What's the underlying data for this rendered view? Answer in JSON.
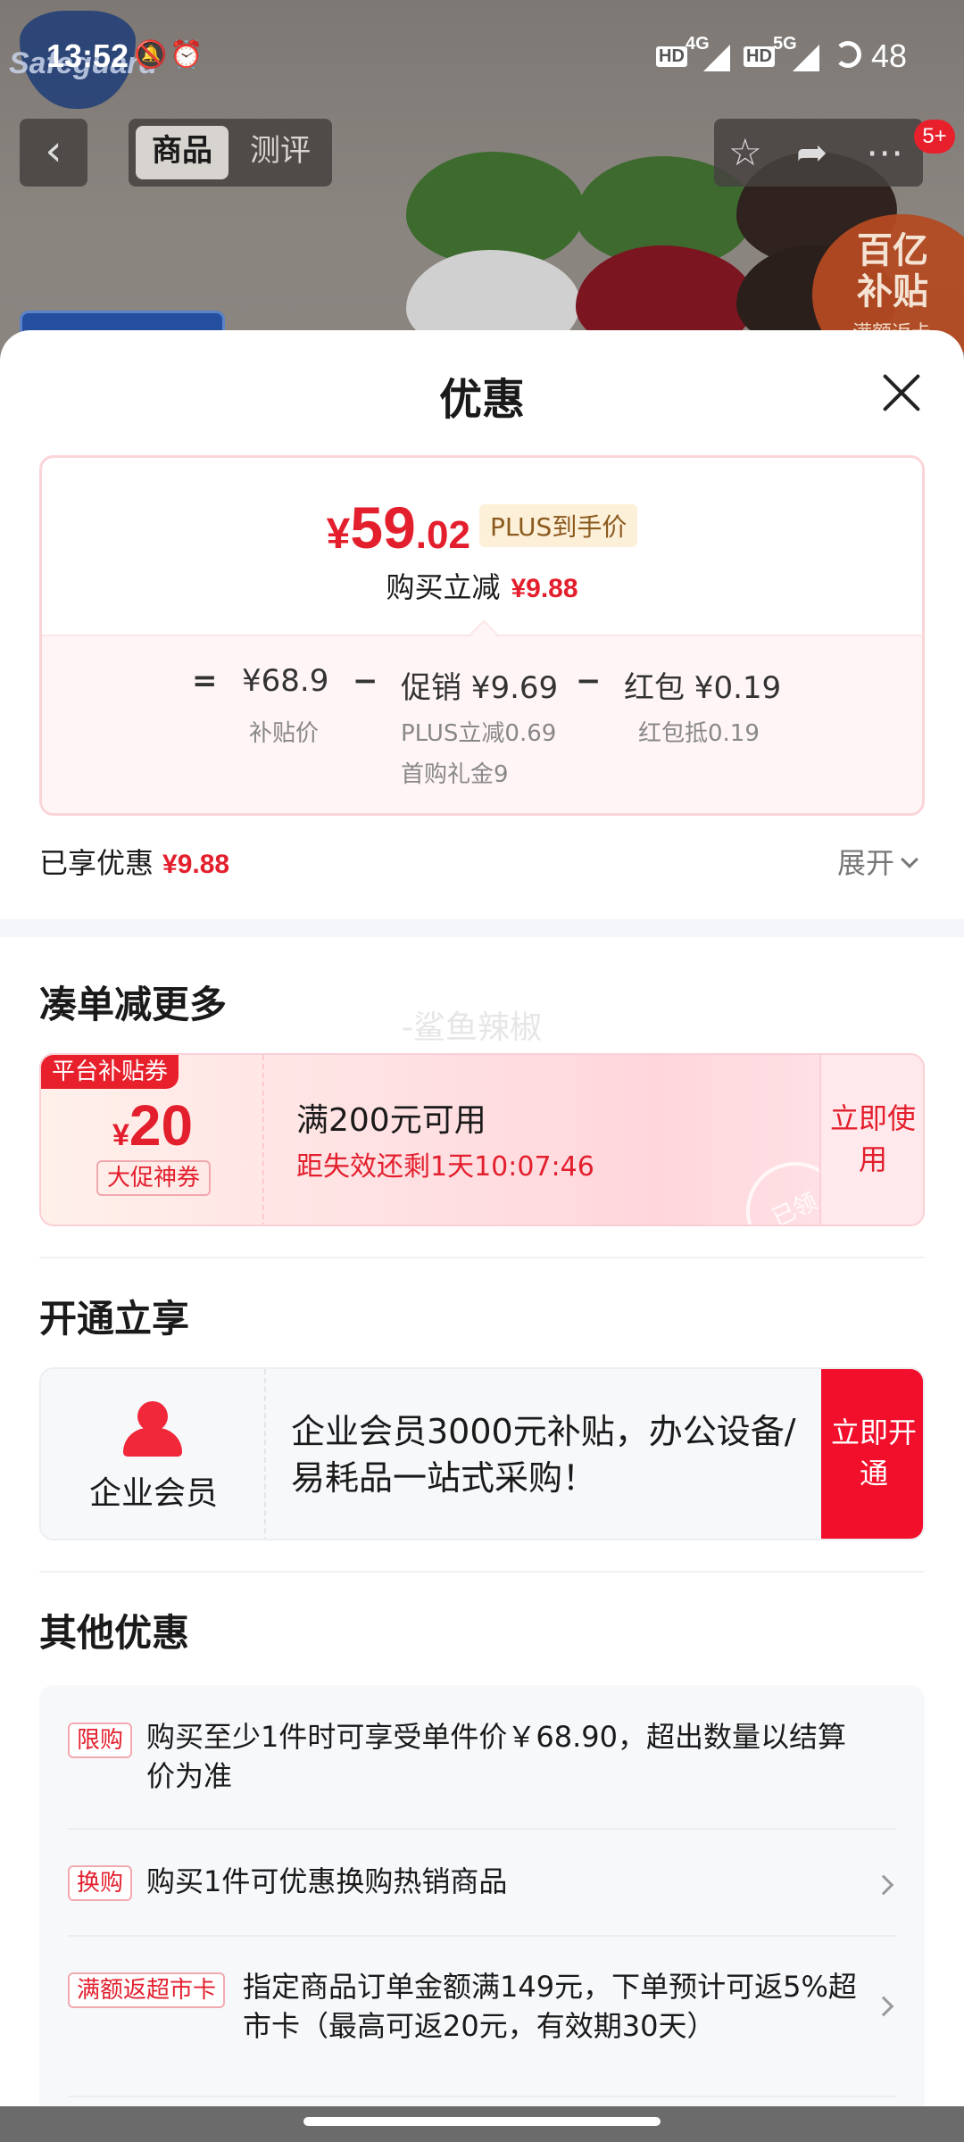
{
  "status_bar": {
    "time": "13:52",
    "net1": "4G",
    "net2": "5G",
    "battery": "48",
    "hd": "HD"
  },
  "product_background": {
    "brand_text": "Safeguard",
    "subsidy_badge": "百亿补贴",
    "subsidy_sub": "满额返卡"
  },
  "nav": {
    "tabs": [
      {
        "label": "商品",
        "active": true
      },
      {
        "label": "测评",
        "active": false
      }
    ],
    "message_badge": "5+"
  },
  "sheet": {
    "title": "优惠"
  },
  "price_card": {
    "currency": "¥",
    "price_int": "59",
    "price_dec": ".02",
    "plus_label": "PLUS到手价",
    "instant_label": "购买立减",
    "instant_value": "¥9.88",
    "calc": {
      "equals": "=",
      "base_value": "¥68.9",
      "base_label": "补贴价",
      "minus1": "−",
      "promo_value": "促销 ¥9.69",
      "promo_sub1": "PLUS立减0.69",
      "promo_sub2": "首购礼金9",
      "minus2": "−",
      "redpack_value": "红包 ¥0.19",
      "redpack_sub": "红包抵0.19"
    }
  },
  "enjoyed": {
    "label": "已享优惠",
    "value": "¥9.88",
    "expand_label": "展开"
  },
  "section_more": {
    "title": "凑单减更多",
    "watermark": "-鲨鱼辣椒",
    "coupon": {
      "flag": "平台补贴券",
      "currency": "¥",
      "amount": "20",
      "kind": "大促神券",
      "condition": "满200元可用",
      "expiry": "距失效还剩1天10:07:46",
      "stamp": "已领",
      "action": "立即使用"
    }
  },
  "section_member": {
    "title": "开通立享",
    "name": "企业会员",
    "description": "企业会员3000元补贴，办公设备/易耗品一站式采购！",
    "action": "立即开通"
  },
  "section_other": {
    "title": "其他优惠",
    "offers": [
      {
        "tag": "限购",
        "text": "购买至少1件时可享受单件价￥68.90，超出数量以结算价为准",
        "has_arrow": false
      },
      {
        "tag": "换购",
        "text": "购买1件可优惠换购热销商品",
        "has_arrow": true
      },
      {
        "tag": "满额返超市卡",
        "text": "指定商品订单金额满149元，下单预计可返5%超市卡（最高可返20元，有效期30天）",
        "has_arrow": true
      }
    ]
  },
  "colors": {
    "accent_red": "#e31f2d",
    "button_red": "#f20f2b",
    "plus_gold": "#8b5a1e"
  }
}
